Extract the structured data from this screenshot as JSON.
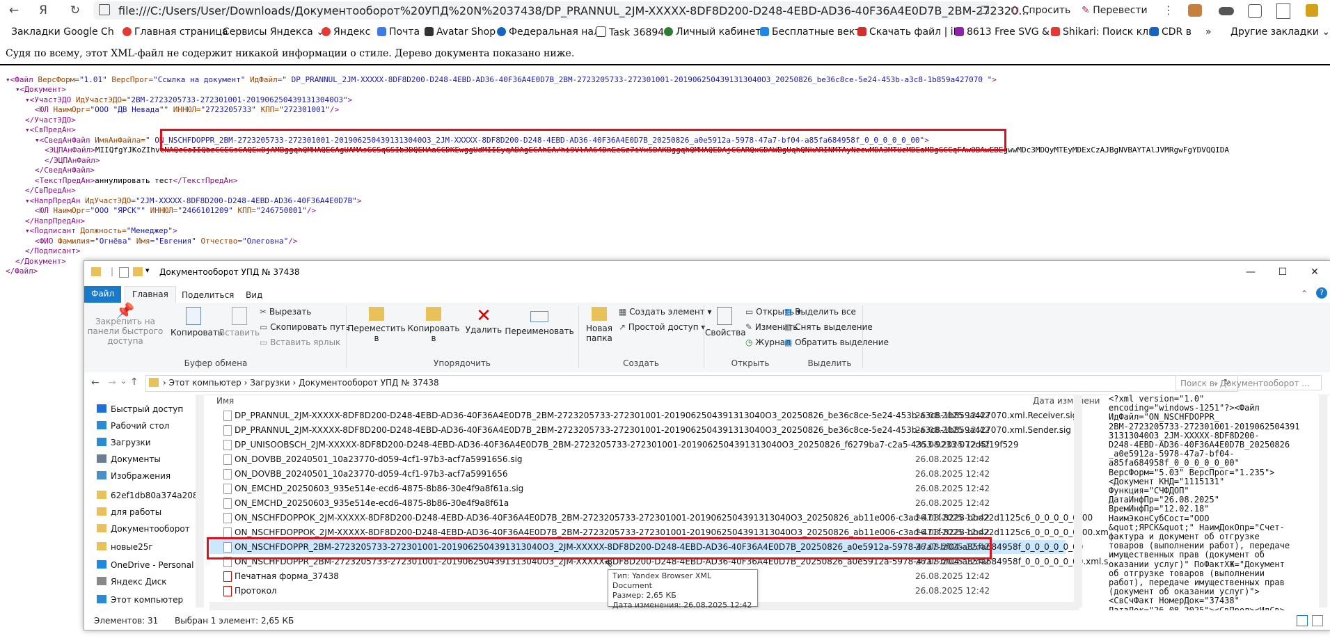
{
  "browser": {
    "url": "file:///C:/Users/User/Downloads/Документооборот%20УПД%20N%2037438/DP_PRANNUL_2JM-XXXXX-8DF8D200-D248-4EBD-AD36-40F36A4E0D7B_2BM-272320...",
    "ask_label": "Спросить",
    "translate_label": "Перевести",
    "bookmarks": [
      {
        "label": "Закладки Google Ch",
        "color": "#4285f4"
      },
      {
        "label": "Главная страница",
        "color": "#e53935"
      },
      {
        "label": "Сервисы Яндекса",
        "color": "#888888"
      },
      {
        "label": "Яндекс",
        "color": "#e53935"
      },
      {
        "label": "Почта",
        "color": "#3f7be6"
      },
      {
        "label": "Avatar Shop",
        "color": "#333333"
      },
      {
        "label": "Федеральная нал",
        "color": "#1565c0"
      },
      {
        "label": "Task 36894",
        "color": "#333333"
      },
      {
        "label": "Личный кабинет",
        "color": "#2e7d32"
      },
      {
        "label": "Бесплатные векто",
        "color": "#1e88e5"
      },
      {
        "label": "Скачать файл | iL",
        "color": "#d32f2f"
      },
      {
        "label": "8613 Free SVG &",
        "color": "#8e24aa"
      },
      {
        "label": "Shikari: Поиск кли",
        "color": "#e53935"
      },
      {
        "label": "CDR в",
        "color": "#1565c0"
      }
    ],
    "other_bookmarks": "Другие закладки",
    "notice": "Судя по всему, этот XML-файл не содержит никакой информации о стиле. Дерево документа показано ниже."
  },
  "xml_lines": [
    {
      "indent": 0,
      "html": "<span class='t'>▾&lt;Файл</span> <span class='a'>ВерсФорм=</span><span class='v'>\"1.01\"</span> <span class='a'>ВерсПрог=</span><span class='v'>\"Ссылка на документ\"</span> <span class='a'>ИдФайл=</span><span class='v'>\" DP_PRANNUL_2JM-XXXXX-8DF8D200-D248-4EBD-AD36-40F36A4E0D7B_2BM-2723205733-272301001-2019062504391313040O3_20250826_be36c8ce-5e24-453b-a3c8-1b859a427070 \"</span><span class='t'>&gt;</span>"
    },
    {
      "indent": 1,
      "html": "<span class='t'>▾&lt;Документ&gt;</span>"
    },
    {
      "indent": 2,
      "html": "<span class='t'>▾&lt;УчастЭДО</span> <span class='a'>ИдУчастЭДО=</span><span class='v'>\"2BM-2723205733-272301001-2019062504391313040O3\"</span><span class='t'>&gt;</span>"
    },
    {
      "indent": 3,
      "html": "<span class='t'>&lt;ЮЛ</span> <span class='a'>НаимОрг=</span><span class='v'>\"ООО \"ДВ Невада\"\"</span> <span class='a'>ИННЮЛ=</span><span class='v'>\"2723205733\"</span> <span class='a'>КПП=</span><span class='v'>\"272301001\"</span><span class='t'>/&gt;</span>"
    },
    {
      "indent": 2,
      "html": "<span class='t'>&lt;/УчастЭДО&gt;</span>"
    },
    {
      "indent": 2,
      "html": "<span class='t'>▾&lt;СвПредАн&gt;</span>"
    },
    {
      "indent": 3,
      "html": "<span class='t'>▾&lt;СведАнФайл</span> <span class='a'>ИмяАнФайла=</span><span class='v'>\" ON_NSCHFDOPPR_2BM-2723205733-272301001-2019062504391313040O3_2JM-XXXXX-8DF8D200-D248-4EBD-AD36-40F36A4E0D7B_20250826_a0e5912a-5978-47a7-bf04-a85fa684958f_0_0_0_0_0_00\"</span><span class='t'>&gt;</span>"
    },
    {
      "indent": 4,
      "html": "<span class='t'>&lt;ЭЦПАнФайл&gt;</span><span class='tx'>MIIQfgYJKoZIhvcNAQcCoIIQbzCCEGsCAQExDjAMBggqhQMHAQECAgUAMAsGCSqGSIb3DQEHAaCCDKEwggUdMIIEyqADAgECAhEA/hi9VlAA64DnEeGz7iYx5DAKBggqhQMHAQEDAjCCARQxGDAWBgUqhQNkARINMTAyNzcwMDA3MTUzMDEaMBgGCCqFAwOBAwEBEgwwMDc3MDQyMTEyMDExCzAJBgNVBAYTAlJVMRgwFgYDVQQIDA</span>"
    },
    {
      "indent": 4,
      "html": "<span class='t'>&lt;/ЭЦПАнФайл&gt;</span>"
    },
    {
      "indent": 3,
      "html": "<span class='t'>&lt;/СведАнФайл&gt;</span>"
    },
    {
      "indent": 3,
      "html": "<span class='t'>&lt;ТекстПредАн&gt;</span><span class='tx'>аннулировать тест</span><span class='t'>&lt;/ТекстПредАн&gt;</span>"
    },
    {
      "indent": 2,
      "html": "<span class='t'>&lt;/СвПредАн&gt;</span>"
    },
    {
      "indent": 2,
      "html": "<span class='t'>▾&lt;НапрПредАн</span> <span class='a'>ИдУчастЭДО=</span><span class='v'>\"2JM-XXXXX-8DF8D200-D248-4EBD-AD36-40F36A4E0D7B\"</span><span class='t'>&gt;</span>"
    },
    {
      "indent": 3,
      "html": "<span class='t'>&lt;ЮЛ</span> <span class='a'>НаимОрг=</span><span class='v'>\"ООО \"ЯРСК\"\"</span> <span class='a'>ИННЮЛ=</span><span class='v'>\"2466101209\"</span> <span class='a'>КПП=</span><span class='v'>\"246750001\"</span><span class='t'>/&gt;</span>"
    },
    {
      "indent": 2,
      "html": "<span class='t'>&lt;/НапрПредАн&gt;</span>"
    },
    {
      "indent": 2,
      "html": "<span class='t'>▾&lt;Подписант</span> <span class='a'>Должность=</span><span class='v'>\"Менеджер\"</span><span class='t'>&gt;</span>"
    },
    {
      "indent": 3,
      "html": "<span class='t'>&lt;ФИО</span> <span class='a'>Фамилия=</span><span class='v'>\"Огнёва\"</span> <span class='a'>Имя=</span><span class='v'>\"Евгения\"</span> <span class='a'>Отчество=</span><span class='v'>\"Олеговна\"</span><span class='t'>/&gt;</span>"
    },
    {
      "indent": 2,
      "html": "<span class='t'>&lt;/Подписант&gt;</span>"
    },
    {
      "indent": 1,
      "html": "<span class='t'>&lt;/Документ&gt;</span>"
    },
    {
      "indent": 0,
      "html": "<span class='t'>&lt;/Файл&gt;</span>"
    }
  ],
  "explorer": {
    "title": "Документооборот УПД № 37438",
    "tabs": [
      "Файл",
      "Главная",
      "Поделиться",
      "Вид"
    ],
    "ribbon": {
      "pin": "Закрепить на панели быстрого доступа",
      "copy": "Копировать",
      "paste": "Вставить",
      "cut": "Вырезать",
      "copy_path": "Скопировать путь",
      "paste_shortcut": "Вставить ярлык",
      "group_clipboard": "Буфер обмена",
      "move_to": "Переместить в",
      "copy_to": "Копировать в",
      "delete": "Удалить",
      "rename": "Переименовать",
      "group_organize": "Упорядочить",
      "new_folder": "Новая папка",
      "new_item": "Создать элемент",
      "easy_access": "Простой доступ",
      "group_create": "Создать",
      "properties": "Свойства",
      "open": "Открыть",
      "edit": "Изменить",
      "history": "Журнал",
      "group_open": "Открыть",
      "select_all": "Выделить все",
      "select_none": "Снять выделение",
      "invert": "Обратить выделение",
      "group_select": "Выделить"
    },
    "breadcrumb": [
      "Этот компьютер",
      "Загрузки",
      "Документооборот УПД № 37438"
    ],
    "search_placeholder": "Поиск в: Документооборот ...",
    "nav": [
      {
        "label": "Быстрый доступ",
        "color": "#1e6fd9"
      },
      {
        "label": "Рабочий стол",
        "color": "#2a8ad4"
      },
      {
        "label": "Загрузки",
        "color": "#2a8ad4"
      },
      {
        "label": "Документы",
        "color": "#6b7c93"
      },
      {
        "label": "Изображения",
        "color": "#4a90c8"
      },
      {
        "label": "62ef1db80a374a208",
        "color": "#e8c15a"
      },
      {
        "label": "для работы",
        "color": "#e8c15a"
      },
      {
        "label": "Документооборот",
        "color": "#e8c15a"
      },
      {
        "label": "новые25г",
        "color": "#e8c15a"
      },
      {
        "label": "OneDrive - Personal",
        "color": "#1e88e5"
      },
      {
        "label": "Яндекс Диск",
        "color": "#888888"
      },
      {
        "label": "Этот компьютер",
        "color": "#2a8ad4"
      }
    ],
    "col_name": "Имя",
    "col_date": "Дата изменени",
    "files": [
      {
        "name": "DP_PRANNUL_2JM-XXXXX-8DF8D200-D248-4EBD-AD36-40F36A4E0D7B_2BM-2723205733-272301001-2019062504391313040O3_20250826_be36c8ce-5e24-453b-a3c8-1b859a427070.xml.Receiver.sig",
        "date": "26.08.2025 12:42",
        "pdf": false
      },
      {
        "name": "DP_PRANNUL_2JM-XXXXX-8DF8D200-D248-4EBD-AD36-40F36A4E0D7B_2BM-2723205733-272301001-2019062504391313040O3_20250826_be36c8ce-5e24-453b-a3c8-1b859a427070.xml.Sender.sig",
        "date": "26.08.2025 12:42",
        "pdf": false
      },
      {
        "name": "DP_UNISOOBSCH_2JM-XXXXX-8DF8D200-D248-4EBD-AD36-40F36A4E0D7B_2BM-2723205733-272301001-2019062504391313040O3_20250826_f6279ba7-c2a5-4353-9233-072d5f19f529",
        "date": "26.08.2025 12:42",
        "pdf": false
      },
      {
        "name": "ON_DOVBB_20240501_10a23770-d059-4cf1-97b3-acf7a5991656.sig",
        "date": "26.08.2025 12:42",
        "pdf": false
      },
      {
        "name": "ON_DOVBB_20240501_10a23770-d059-4cf1-97b3-acf7a5991656",
        "date": "26.08.2025 12:42",
        "pdf": false
      },
      {
        "name": "ON_EMCHD_20250603_935e514e-ecd6-4875-8b86-30e4f9a8f61a.sig",
        "date": "26.08.2025 12:42",
        "pdf": false
      },
      {
        "name": "ON_EMCHD_20250603_935e514e-ecd6-4875-8b86-30e4f9a8f61a",
        "date": "26.08.2025 12:42",
        "pdf": false
      },
      {
        "name": "ON_NSCHFDOPPOK_2JM-XXXXX-8DF8D200-D248-4EBD-AD36-40F36A4E0D7B_2BM-2723205733-272301001-2019062504391313040O3_20250826_ab11e006-c3ad-471f-8228-bbd22d1125c6_0_0_0_0_0_00",
        "date": "26.08.2025 12:42",
        "pdf": false
      },
      {
        "name": "ON_NSCHFDOPPOK_2JM-XXXXX-8DF8D200-D248-4EBD-AD36-40F36A4E0D7B_2BM-2723205733-272301001-2019062504391313040O3_20250826_ab11e006-c3ad-471f-8228-bbd22d1125c6_0_0_0_0_0_00.xml.sig",
        "date": "26.08.2025 12:42",
        "pdf": false
      },
      {
        "name": "ON_NSCHFDOPPR_2BM-2723205733-272301001-2019062504391313040O3_2JM-XXXXX-8DF8D200-D248-4EBD-AD36-40F36A4E0D7B_20250826_a0e5912a-5978-47a7-bf04-a85fa684958f_0_0_0_0_0_00",
        "date": "26.08.2025 12:42",
        "pdf": false,
        "selected": true
      },
      {
        "name": "ON_NSCHFDOPPR_2BM-2723205733-272301001-2019062504391313040O3_2JM-XXXXX-8DF8D200-D248-4EBD-AD36-40F36A4E0D7B_20250826_a0e5912a-5978-47a7-bf04-a85fa684958f_0_0_0_0_0_00.xml.sig",
        "date": "26.08.2025 12:42",
        "pdf": false
      },
      {
        "name": "Печатная форма_37438",
        "date": "26.08.2025 12:42",
        "pdf": true
      },
      {
        "name": "Протокол",
        "date": "26.08.2025 12:42",
        "pdf": true
      }
    ],
    "preview": "<?xml version=\"1.0\"\nencoding=\"windows-1251\"?><Файл\nИдФайл=\"ON_NSCHFDOPPR_\n2BM-2723205733-272301001-2019062504391\n31313040O3_2JM-XXXXX-8DF8D200-\nD248-4EBD-AD36-40F36A4E0D7B_20250826\n_a0e5912a-5978-47a7-bf04-\na85fa684958f_0_0_0_0_0_00\"\nВерсФорм=\"5.03\" ВерсПрог=\"1.235\">\n<Документ КНД=\"1115131\"\nФункция=\"СЧФДОП\"\nДатаИнфПр=\"26.08.2025\"\nВремИнфПр=\"12.02.18\"\nНаимЭконСубСост=\"ООО\n&quot;ЯРСК&quot;\" НаимДокОпр=\"Счет-\nфактура и документ об отгрузке\nтоваров (выполнении работ), передаче\nимущественных прав (документ об\nоказании услуг)\" ПоФактХЖ=\"Документ\nоб отгрузке товаров (выполнении\nработ), передаче имущественных прав\n(документ об оказании услуг)\">\n<СвСчФакт НомерДок=\"37438\"\nДатаДок=\"26.08.2025\"><СвПрод><ИдСв>\n<СвЮЛУч НаимОрг=\"ООО",
    "status_count": "Элементов: 31",
    "status_selected": "Выбран 1 элемент: 2,65 КБ",
    "tooltip": {
      "type": "Тип: Yandex Browser XML Document",
      "size": "Размер: 2,65 КБ",
      "date": "Дата изменения: 26.08.2025 12:42"
    }
  }
}
